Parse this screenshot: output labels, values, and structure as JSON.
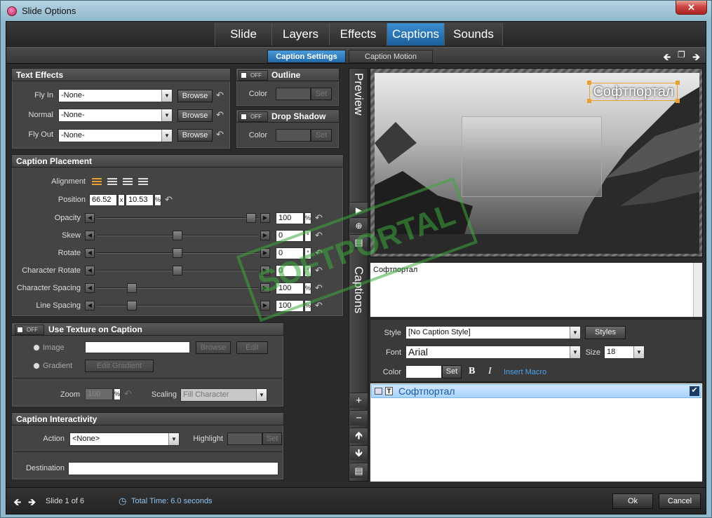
{
  "window": {
    "title": "Slide Options",
    "close": "✕"
  },
  "main_tabs": [
    "Slide",
    "Layers",
    "Effects",
    "Captions",
    "Sounds"
  ],
  "sub_tabs": [
    "Caption Settings",
    "Caption Motion"
  ],
  "text_effects": {
    "title": "Text Effects",
    "rows": [
      {
        "label": "Fly In",
        "value": "-None-",
        "button": "Browse"
      },
      {
        "label": "Normal",
        "value": "-None-",
        "button": "Browse"
      },
      {
        "label": "Fly Out",
        "value": "-None-",
        "button": "Browse"
      }
    ]
  },
  "outline": {
    "title": "Outline",
    "toggle": "OFF",
    "color_label": "Color",
    "set": "Set"
  },
  "drop_shadow": {
    "title": "Drop Shadow",
    "toggle": "OFF",
    "color_label": "Color",
    "set": "Set"
  },
  "placement": {
    "title": "Caption Placement",
    "alignment_label": "Alignment",
    "position_label": "Position",
    "pos_x": "66.52",
    "x_sep": "x",
    "pos_y": "10.53",
    "pct": "%",
    "sliders": [
      {
        "label": "Opacity",
        "value": "100",
        "unit": "%",
        "level": 0.98
      },
      {
        "label": "Skew",
        "value": "0",
        "unit": "°",
        "level": 0.5
      },
      {
        "label": "Rotate",
        "value": "0",
        "unit": "°",
        "level": 0.5
      },
      {
        "label": "Character Rotate",
        "value": "0",
        "unit": "°",
        "level": 0.5
      },
      {
        "label": "Character Spacing",
        "value": "100",
        "unit": "%",
        "level": 0.2
      },
      {
        "label": "Line Spacing",
        "value": "100",
        "unit": "%",
        "level": 0.2
      }
    ]
  },
  "texture": {
    "title": "Use Texture on Caption",
    "toggle": "OFF",
    "image_label": "Image",
    "gradient_label": "Gradient",
    "browse": "Browse",
    "edit": "Edit",
    "edit_gradient": "Edit Gradient",
    "zoom_label": "Zoom",
    "zoom_value": "100",
    "pct": "%",
    "scaling_label": "Scaling",
    "scaling_value": "Fill Character"
  },
  "interactivity": {
    "title": "Caption Interactivity",
    "action_label": "Action",
    "action_value": "<None>",
    "highlight_label": "Highlight",
    "set": "Set",
    "destination_label": "Destination"
  },
  "side_labels": {
    "preview": "Preview",
    "captions": "Captions"
  },
  "preview": {
    "caption_text": "Софтпортал"
  },
  "watermark": "SOFTPORTAL",
  "caption_text": "Софтпортал",
  "caption_props": {
    "style_label": "Style",
    "style_value": "[No Caption Style]",
    "styles_button": "Styles",
    "font_label": "Font",
    "font_value": "Arial",
    "size_label": "Size",
    "size_value": "18",
    "color_label": "Color",
    "set": "Set",
    "bold": "B",
    "italic": "I",
    "insert_macro": "Insert Macro"
  },
  "caption_list": [
    {
      "text": "Софтпортал",
      "checked": true
    }
  ],
  "footer": {
    "slide": "Slide 1 of 6",
    "total_time": "Total Time: 6.0 seconds",
    "ok": "Ok",
    "cancel": "Cancel"
  },
  "colors": {
    "accent": "#2f7fc4",
    "highlight": "#e8a030"
  }
}
